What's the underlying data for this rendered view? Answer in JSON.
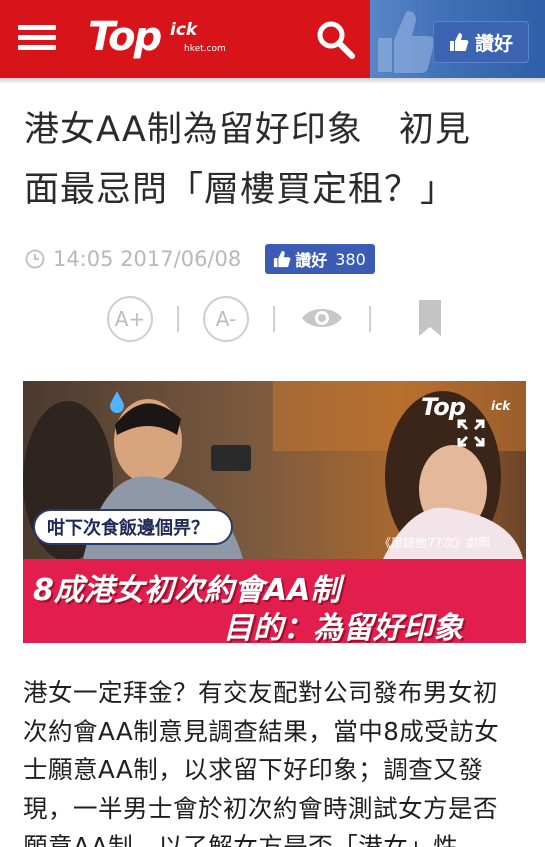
{
  "header": {
    "logo_main": "Top",
    "logo_sup": "ick",
    "logo_sub": "hket.com",
    "like_label": "讚好",
    "colors": {
      "brand_red": "#d8141b",
      "facebook_blue": "#3b5bb5"
    }
  },
  "article": {
    "title_lines": [
      "港女AA制為留好印象　初見",
      "面最忌問「層樓買定租？」"
    ],
    "timestamp": "14:05 2017/06/08",
    "fb_like_label": "讚好",
    "fb_like_count": "380",
    "toolbar": {
      "font_up": "A+",
      "font_down": "A-"
    },
    "image": {
      "watermark_main": "Top",
      "watermark_sup": "ick",
      "bubble_text": "咁下次食飯邊個畀？",
      "caption": "《原諒他77次》劇照",
      "banner_line1": "8成港女初次約會AA制",
      "banner_line2": "目的：為留好印象"
    },
    "body_lines": [
      "港女一定拜金？有交友配對公司發布男女初",
      "次約會AA制意見調查結果，當中8成受訪女",
      "士願意AA制，以求留下好印象；調查又發",
      "現，一半男士會於初次約會時測試女方是否",
      "願意AA制，以了解女方是否「港女」性"
    ]
  },
  "icons": [
    "menu-icon",
    "search-icon",
    "thumbs-up-icon",
    "clock-icon",
    "eye-icon",
    "bookmark-icon",
    "expand-icon"
  ]
}
